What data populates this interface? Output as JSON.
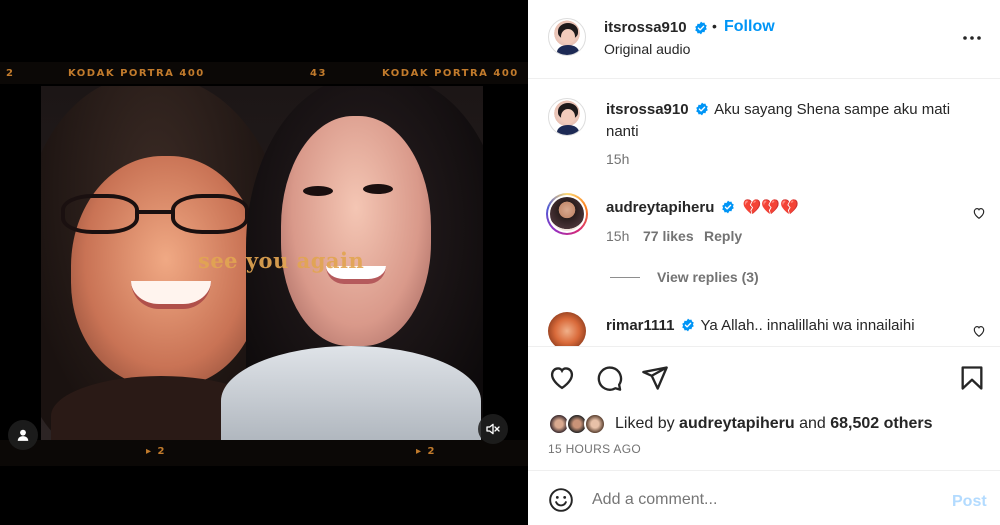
{
  "media": {
    "film_labels": {
      "top_left_num": "2",
      "top_left_brand": "KODAK PORTRA 400",
      "top_mid_num": "43",
      "top_right_brand": "KODAK PORTRA 400",
      "bottom_left": "▸ 2",
      "bottom_right": "▸ 2"
    },
    "overlay_text": "see you again",
    "user_tag_icon": "person-icon",
    "mute_icon": "speaker-muted-icon"
  },
  "header": {
    "username": "itsrossa910",
    "separator": "•",
    "follow_label": "Follow",
    "subtitle": "Original audio",
    "more_icon": "more-horizontal-icon"
  },
  "comments": [
    {
      "username": "itsrossa910",
      "text": "Aku sayang Shena sampe aku mati nanti",
      "time": "15h"
    },
    {
      "username": "audreytapiheru",
      "text": "💔💔💔",
      "time": "15h",
      "likes": "77 likes",
      "reply_label": "Reply",
      "view_replies": "View replies (3)"
    },
    {
      "username": "rimar1111",
      "text": "Ya Allah.. innalillahi wa innailaihi"
    }
  ],
  "actions": {
    "liked_by_prefix": "Liked by",
    "liked_by_user": "audreytapiheru",
    "liked_by_and": "and",
    "liked_by_count": "68,502 others",
    "timestamp": "15 HOURS AGO"
  },
  "add_comment": {
    "placeholder": "Add a comment...",
    "post_label": "Post"
  },
  "colors": {
    "accent": "#0095f6",
    "verified": "#0095f6",
    "film_text": "#c27b2c",
    "overlay_text": "#e2a552",
    "post_disabled": "#b3dbff"
  }
}
